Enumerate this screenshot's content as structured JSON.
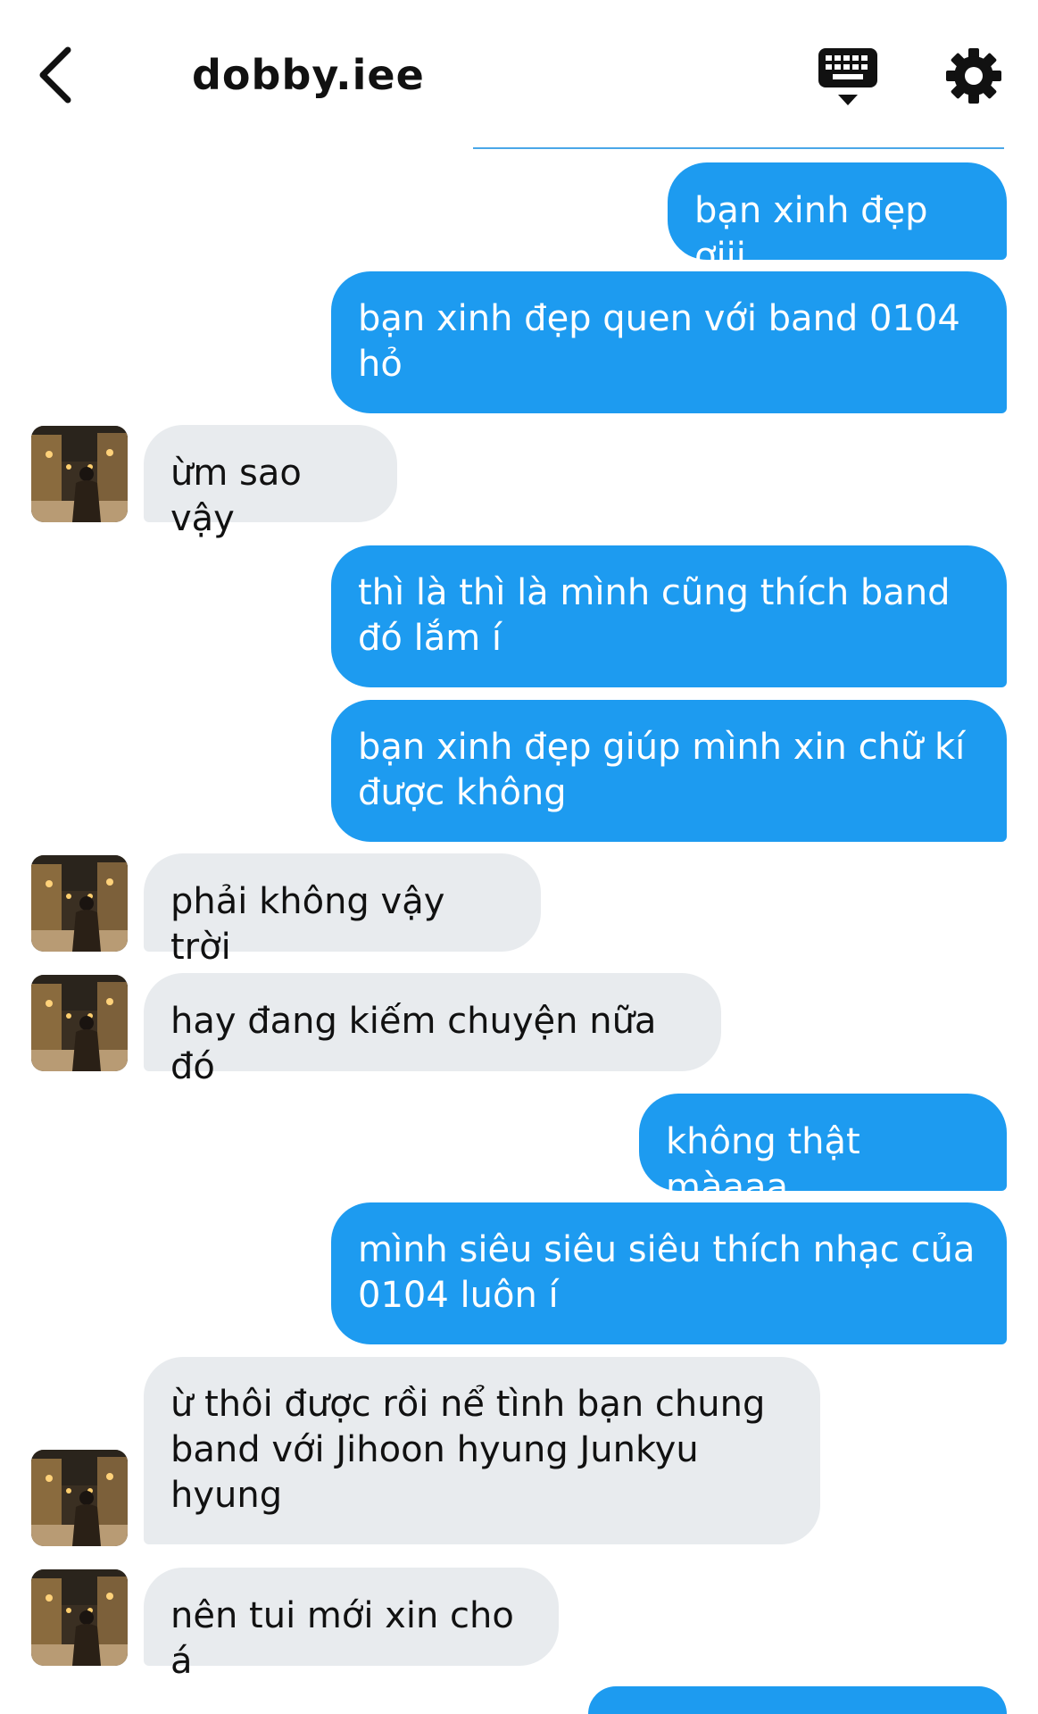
{
  "header": {
    "title": "dobby.iee",
    "back_icon": "chevron-left-icon",
    "keyboard_icon": "keyboard-icon",
    "settings_icon": "gear-icon"
  },
  "colors": {
    "sent_bubble": "#1d9bf0",
    "received_bubble": "#e8ebee"
  },
  "messages": [
    {
      "from": "me",
      "text": "bạn xinh đẹp ơiii"
    },
    {
      "from": "me",
      "text": "bạn xinh đẹp quen với band 0104 hỏ"
    },
    {
      "from": "them",
      "text": "ừm sao vậy"
    },
    {
      "from": "me",
      "text": "thì là thì là mình cũng thích band đó lắm í"
    },
    {
      "from": "me",
      "text": "bạn xinh đẹp giúp mình xin chữ kí được không"
    },
    {
      "from": "them",
      "text": "phải không vậy trời"
    },
    {
      "from": "them",
      "text": "hay đang kiếm chuyện nữa đó"
    },
    {
      "from": "me",
      "text": "không thật màaaa"
    },
    {
      "from": "me",
      "text": "mình siêu siêu siêu thích nhạc của 0104 luôn í"
    },
    {
      "from": "them",
      "text": "ừ thôi được rồi nể tình bạn chung band với Jihoon hyung Junkyu hyung"
    },
    {
      "from": "them",
      "text": "nên tui mới xin cho á"
    }
  ]
}
